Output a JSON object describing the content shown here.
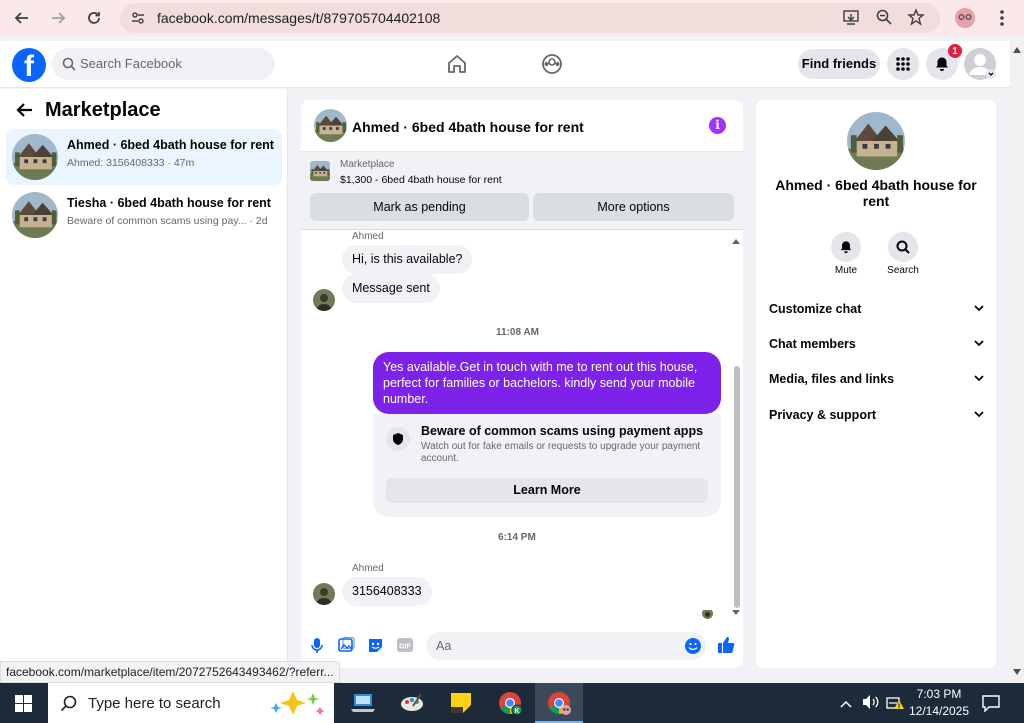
{
  "browser": {
    "url": "facebook.com/messages/t/879705704402108",
    "status_url": "facebook.com/marketplace/item/2072752643493462/?referr..."
  },
  "header": {
    "search_placeholder": "Search Facebook",
    "find_friends": "Find friends",
    "notification_count": "1"
  },
  "sidebar": {
    "title": "Marketplace",
    "conversations": [
      {
        "name": "Ahmed · 6bed 4bath house for rent",
        "preview": "Ahmed: 3156408333 · 47m",
        "active": true
      },
      {
        "name": "Tiesha · 6bed 4bath house for rent",
        "preview": "Beware of common scams using pay...",
        "time": "· 2d",
        "active": false
      }
    ]
  },
  "chat": {
    "title": "Ahmed · 6bed 4bath house for rent",
    "listing": {
      "label": "Marketplace",
      "detail": "$1,300 - 6bed 4bath house for rent",
      "mark_pending": "Mark as pending",
      "more_options": "More options"
    },
    "messages": {
      "sender1": "Ahmed",
      "in1": "Hi, is this available?",
      "in2": "Message sent",
      "time1": "11:08 AM",
      "out1": "Yes available.Get in touch with me to rent out this  house, perfect for families or bachelors. kindly send your mobile number.",
      "scam_title": "Beware of common scams using payment apps",
      "scam_desc": "Watch out for fake emails or requests to upgrade your payment account.",
      "learn_more": "Learn More",
      "time2": "6:14 PM",
      "sender2": "Ahmed",
      "in3": "3156408333"
    },
    "composer_placeholder": "Aa"
  },
  "details": {
    "name": "Ahmed · 6bed 4bath house for rent",
    "mute": "Mute",
    "search": "Search",
    "rows": [
      "Customize chat",
      "Chat members",
      "Media, files and links",
      "Privacy & support"
    ]
  },
  "taskbar": {
    "search_placeholder": "Type here to search",
    "time": "7:03 PM",
    "date": "12/14/2025"
  },
  "colors": {
    "brand": "#0866ff",
    "outgoing_bubble": "#7d22e8",
    "notification": "#e41e3f"
  }
}
